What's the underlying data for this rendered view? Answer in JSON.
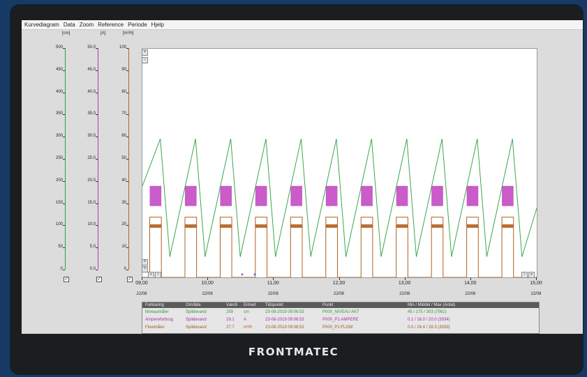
{
  "menu": [
    "Kurvediagram",
    "Data",
    "Zoom",
    "Reference",
    "Periode",
    "Hjelp"
  ],
  "axes": [
    {
      "unit": "[cm]",
      "color": "#2e9e3e",
      "ticks": [
        "500",
        "450",
        "400",
        "350",
        "300",
        "250",
        "200",
        "150",
        "100",
        "50",
        "0"
      ]
    },
    {
      "unit": "[A]",
      "color": "#b03ab0",
      "ticks": [
        "50.0",
        "45.0",
        "40.0",
        "35.0",
        "30.0",
        "25.0",
        "20.0",
        "15.0",
        "10.0",
        "5.0",
        "0.0"
      ]
    },
    {
      "unit": "[m³/h]",
      "color": "#b5652a",
      "ticks": [
        "100",
        "90",
        "80",
        "70",
        "60",
        "50",
        "40",
        "30",
        "20",
        "10",
        "0"
      ]
    }
  ],
  "checkbox_mark": "✓",
  "x_axis": {
    "ticks": [
      "09,00",
      "10,00",
      "11,00",
      "12,00",
      "13,00",
      "14,00",
      "15,00"
    ],
    "dates": [
      "22/08",
      "22/08",
      "22/08",
      "22/08",
      "22/08",
      "22/08",
      "22/08"
    ]
  },
  "chart_data": {
    "type": "line",
    "x": [
      "09:00",
      "10:00",
      "11:00",
      "12:00",
      "13:00",
      "14:00",
      "15:00"
    ],
    "ylim_left_axes": {
      "cm": [
        0,
        500
      ],
      "A": [
        0,
        50
      ],
      "m3h": [
        0,
        100
      ]
    },
    "grid": false,
    "series": [
      {
        "name": "Niveaumåler",
        "color": "#3aa84a",
        "pattern": "sawtooth",
        "min": 45,
        "max": 303,
        "unit": "cm"
      },
      {
        "name": "Ampereforbrug",
        "color": "#c040c0",
        "pattern": "pulses",
        "min": 0.1,
        "max": 20.0,
        "unit": "A"
      },
      {
        "name": "Flowmåler",
        "color": "#b0601f",
        "pattern": "pulses",
        "min": 0.0,
        "max": 28.3,
        "unit": "m³/h"
      }
    ],
    "cycles": 11
  },
  "legend": {
    "headers": [
      "Forklaring",
      "Område",
      "Værdi",
      "Enhed",
      "Tidspunkt",
      "Punkt",
      "Min / Middel / Max (Antal)"
    ],
    "rows": [
      {
        "label": "Niveaumåler",
        "area": "Spildevand",
        "value": "259",
        "unit": "cm",
        "time": "23-08-2019 09:06:53",
        "point": "P000_NIVEAU AKT",
        "stats": "45 / 175 / 303 (7562)",
        "color": "#2f9a3d"
      },
      {
        "label": "Ampereforbrug",
        "area": "Spildevand",
        "value": "19.1",
        "unit": "A",
        "time": "23-08-2019 09:06:53",
        "point": "P000_P1:AMPERE",
        "stats": "0.1 / 16.0 / 20.0 (3034)",
        "color": "#a8329e"
      },
      {
        "label": "Flowmåler",
        "area": "Spildevand",
        "value": "27.7",
        "unit": "m³/h",
        "time": "23-08-2019 09:06:53",
        "point": "P000_P1:FLOW",
        "stats": "0.0 / 24.4 / 28.3 (3039)",
        "color": "#a35a22"
      }
    ]
  },
  "brand": "FRONTMATEC"
}
